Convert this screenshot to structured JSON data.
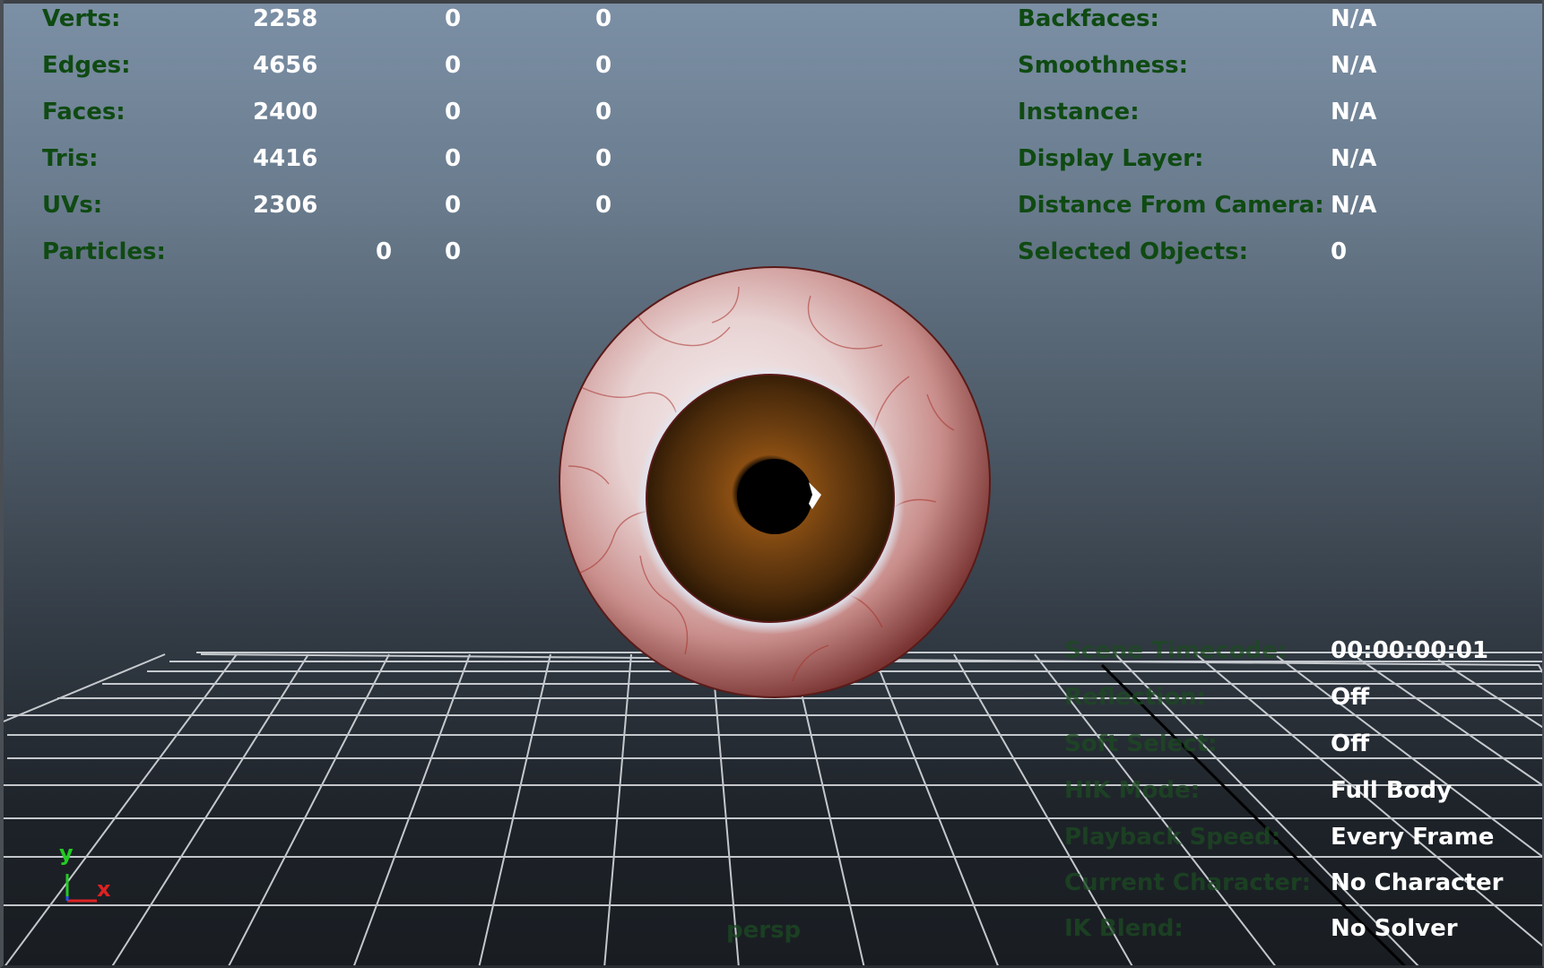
{
  "poly_stats": [
    {
      "label": "Verts:",
      "values": [
        "2258",
        "0",
        "0"
      ]
    },
    {
      "label": "Edges:",
      "values": [
        "4656",
        "0",
        "0"
      ]
    },
    {
      "label": "Faces:",
      "values": [
        "2400",
        "0",
        "0"
      ]
    },
    {
      "label": "Tris:",
      "values": [
        "4416",
        "0",
        "0"
      ]
    },
    {
      "label": "UVs:",
      "values": [
        "2306",
        "0",
        "0"
      ]
    },
    {
      "label": "Particles:",
      "values": [
        "0",
        "0"
      ]
    }
  ],
  "object_info": [
    {
      "label": "Backfaces:",
      "value": "N/A"
    },
    {
      "label": "Smoothness:",
      "value": "N/A"
    },
    {
      "label": "Instance:",
      "value": "N/A"
    },
    {
      "label": "Display Layer:",
      "value": "N/A"
    },
    {
      "label": "Distance From Camera:",
      "value": "N/A"
    },
    {
      "label": "Selected Objects:",
      "value": "0"
    }
  ],
  "scene_info": [
    {
      "label": "Scene Timecode:",
      "value": "00:00:00:01"
    },
    {
      "label": "Reflection:",
      "value": "Off"
    },
    {
      "label": "Soft Select:",
      "value": "Off"
    },
    {
      "label": "HIK Mode:",
      "value": "Full Body"
    },
    {
      "label": "Playback Speed:",
      "value": "Every Frame"
    },
    {
      "label": "Current Character:",
      "value": "No Character"
    },
    {
      "label": "IK Blend:",
      "value": "No Solver"
    }
  ],
  "camera_label": "persp",
  "axis_labels": {
    "y": "y",
    "x": "x"
  },
  "icons": [
    "axis-gizmo-icon"
  ],
  "colors": {
    "hud_label": "#0f4a12",
    "hud_value": "#ffffff",
    "grid": "#d8dce0",
    "axis_y": "#22cc22",
    "axis_x": "#dd2222",
    "axis_z": "#2255ee"
  }
}
